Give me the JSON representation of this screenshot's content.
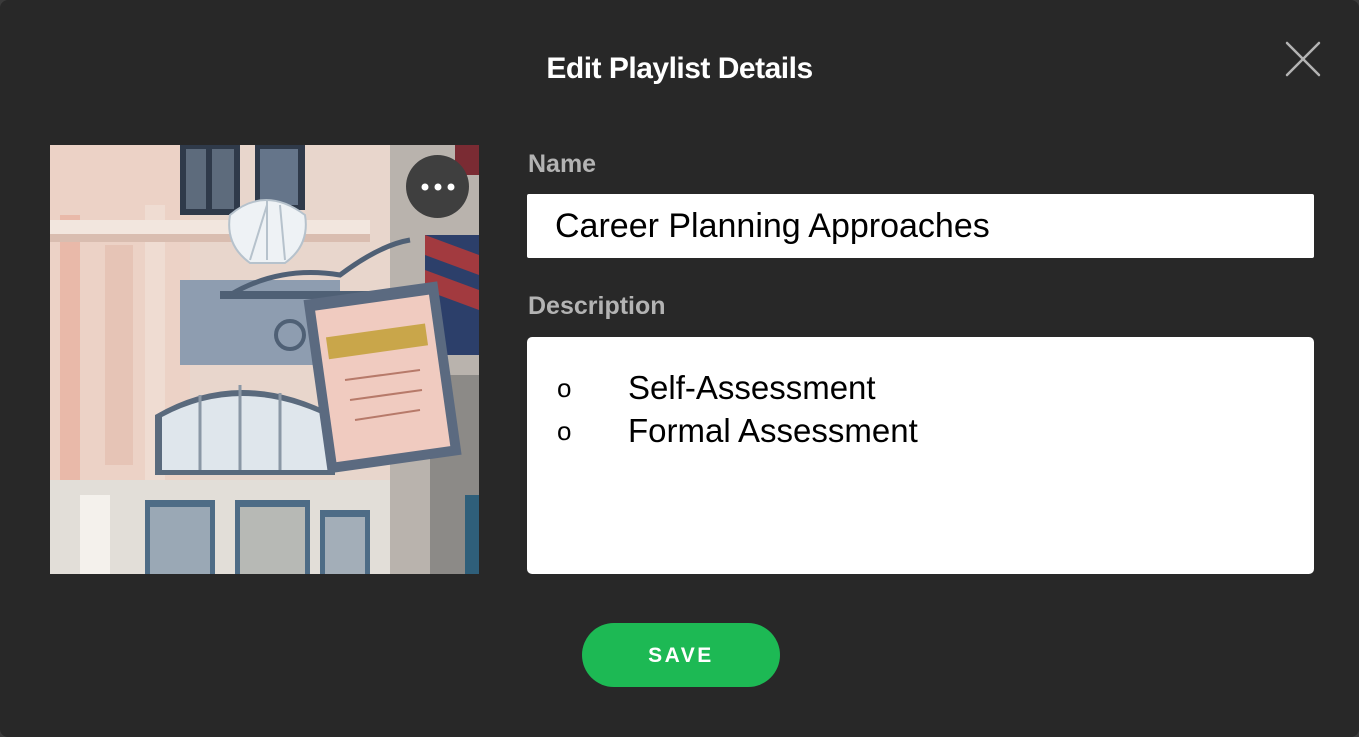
{
  "dialog": {
    "title": "Edit Playlist Details",
    "close_icon": "close-icon"
  },
  "cover": {
    "more_icon": "more-horizontal-icon"
  },
  "form": {
    "name_label": "Name",
    "name_value": "Career Planning Approaches",
    "description_label": "Description",
    "description_items": [
      {
        "bullet": "o",
        "text": "Self-Assessment"
      },
      {
        "bullet": "o",
        "text": "Formal Assessment"
      }
    ]
  },
  "actions": {
    "save_label": "SAVE"
  },
  "colors": {
    "background": "#282828",
    "accent": "#1db954",
    "label": "#b3b3b3"
  }
}
